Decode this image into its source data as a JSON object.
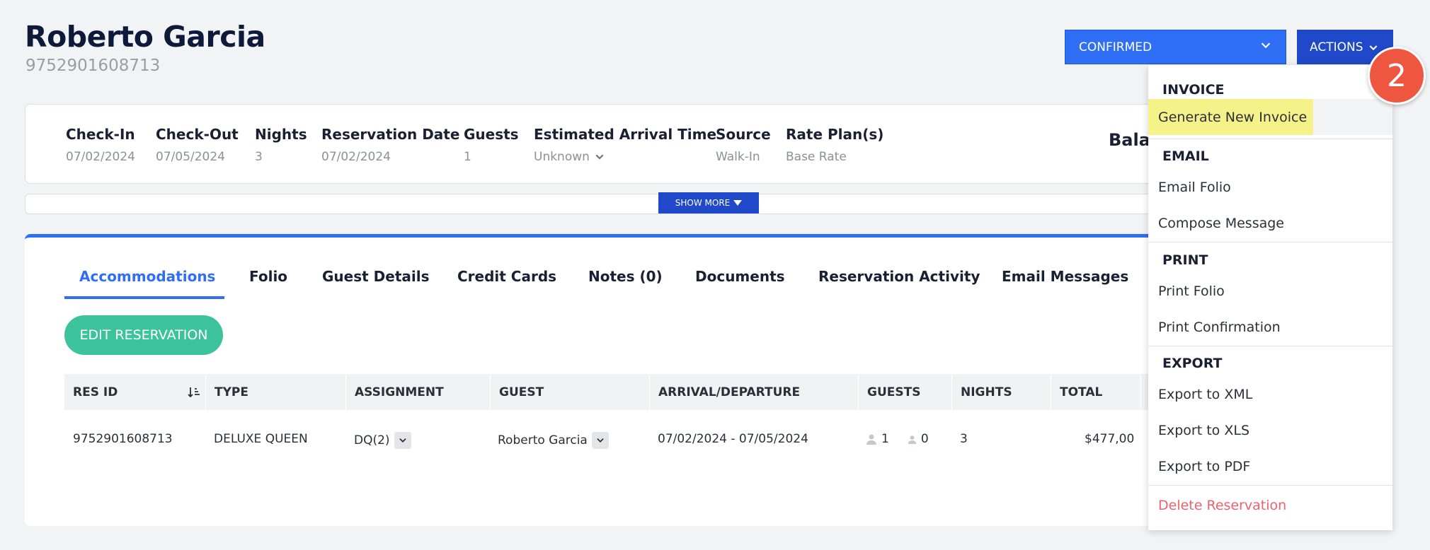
{
  "guest": {
    "name": "Roberto Garcia",
    "id": "9752901608713"
  },
  "header": {
    "status": "CONFIRMED",
    "actions_label": "ACTIONS"
  },
  "reservation_info": {
    "check_in_label": "Check-In",
    "check_in": "07/02/2024",
    "check_out_label": "Check-Out",
    "check_out": "07/05/2024",
    "nights_label": "Nights",
    "nights": "3",
    "res_date_label": "Reservation Date",
    "res_date": "07/02/2024",
    "guests_label": "Guests",
    "guests": "1",
    "eta_label": "Estimated Arrival Time",
    "eta": "Unknown",
    "source_label": "Source",
    "source": "Walk-In",
    "rate_label": "Rate Plan(s)",
    "rate": "Base Rate",
    "balance_label": "Bala"
  },
  "show_more_label": "SHOW MORE",
  "tabs": [
    {
      "label": "Accommodations"
    },
    {
      "label": "Folio"
    },
    {
      "label": "Guest Details"
    },
    {
      "label": "Credit Cards"
    },
    {
      "label": "Notes (0)"
    },
    {
      "label": "Documents"
    },
    {
      "label": "Reservation Activity"
    },
    {
      "label": "Email Messages"
    }
  ],
  "edit_reservation_label": "EDIT RESERVATION",
  "table": {
    "columns": [
      "RES ID",
      "TYPE",
      "ASSIGNMENT",
      "GUEST",
      "ARRIVAL/DEPARTURE",
      "GUESTS",
      "NIGHTS",
      "TOTAL"
    ],
    "row": {
      "res_id": "9752901608713",
      "type": "DELUXE QUEEN",
      "assignment": "DQ(2)",
      "guest": "Roberto Garcia",
      "dates": "07/02/2024 - 07/05/2024",
      "adults": "1",
      "children": "0",
      "nights": "3",
      "total": "$477,00"
    }
  },
  "actions_menu": {
    "invoice_header": "INVOICE",
    "generate_invoice": "Generate New Invoice",
    "email_header": "EMAIL",
    "email_folio": "Email Folio",
    "compose_message": "Compose Message",
    "print_header": "PRINT",
    "print_folio": "Print Folio",
    "print_confirmation": "Print Confirmation",
    "export_header": "EXPORT",
    "export_xml": "Export to XML",
    "export_xls": "Export to XLS",
    "export_pdf": "Export to PDF",
    "delete_reservation": "Delete Reservation"
  },
  "step_badge": "2"
}
